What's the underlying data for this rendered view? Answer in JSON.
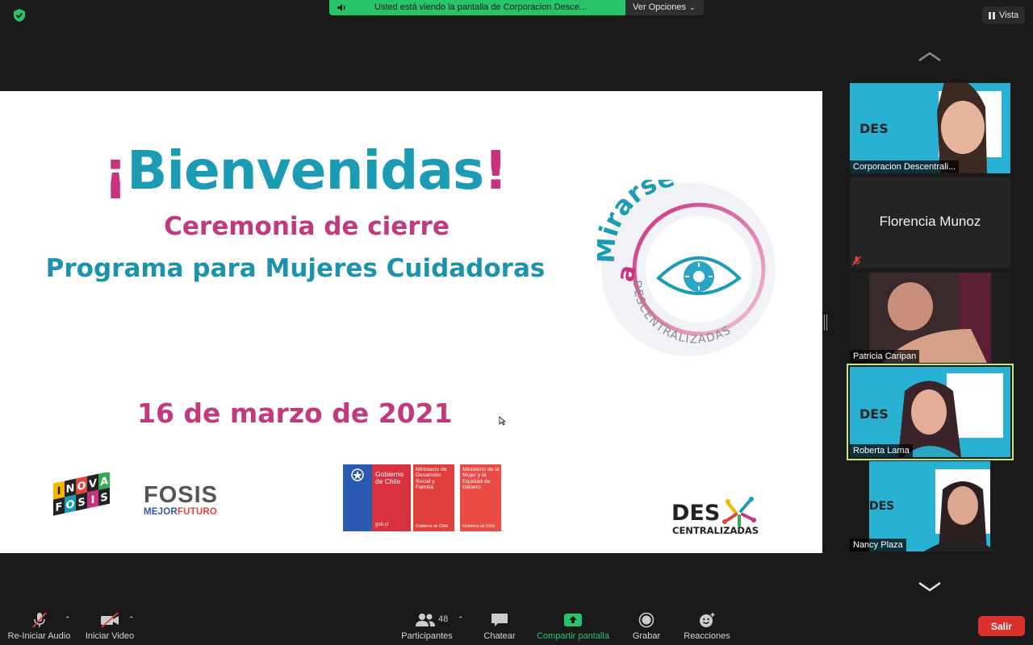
{
  "top_bar": {
    "share_banner": "Usted está viendo la pantalla de Corporacion Desce...",
    "view_options": "Ver Opciones",
    "vista": "Vista"
  },
  "slide": {
    "title_open": "¡",
    "title_main": "Bienvenidas",
    "title_close": "!",
    "subtitle1": "Ceremonia de cierre",
    "subtitle2": "Programa para Mujeres Cuidadoras",
    "date": "16 de marzo de 2021",
    "mirarse_logo": {
      "a": "a",
      "word": "Mirarse",
      "ring_text": "DESCENTRALIZADAS"
    },
    "logos": {
      "inova_letters": [
        "I",
        "N",
        "O",
        "V",
        "A",
        "F",
        "O",
        "S",
        "I",
        "S"
      ],
      "fosis": "FOSIS",
      "fosis_mejor": "MEJOR",
      "fosis_futuro": "FUTURO",
      "gobierno": "Gobierno de Chile",
      "gob_url": "gob.cl",
      "min_desarrollo": "Ministerio de Desarrollo Social y Familia",
      "min_mujer": "Ministerio de la Mujer y la Equidad de Género",
      "min_footer": "Gobierno de Chile",
      "des_top": "DES",
      "des_bottom": "CENTRALIZADAS"
    }
  },
  "participants": [
    {
      "name": "Corporacion Descentrali...",
      "video": true,
      "active": false
    },
    {
      "name": "Florencia Munoz",
      "video": false,
      "muted": true,
      "active": false
    },
    {
      "name": "Patricia Caripan",
      "video": true,
      "active": false
    },
    {
      "name": "Roberta Lama",
      "video": true,
      "active": true
    },
    {
      "name": "Nancy Plaza",
      "video": true,
      "active": false
    }
  ],
  "toolbar": {
    "audio": "Re-Iniciar Audio",
    "video": "Iniciar Video",
    "participants": "Participantes",
    "participants_count": "48",
    "chat": "Chatear",
    "share": "Compartir pantalla",
    "record": "Grabar",
    "reactions": "Reacciones",
    "leave": "Salir"
  },
  "colors": {
    "zoom_green": "#29c36a",
    "slide_teal": "#1b9bb4",
    "slide_pink": "#c2397d",
    "leave_red": "#d9302b",
    "active_speaker": "#c3e87e"
  }
}
